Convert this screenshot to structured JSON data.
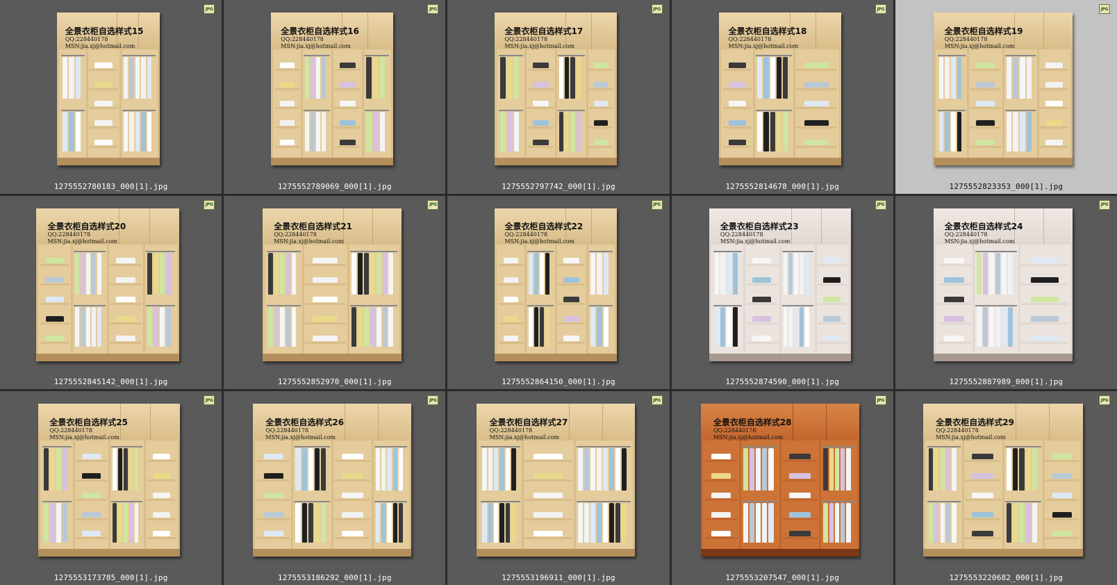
{
  "badge_label": "JPG",
  "wardrobe_text": {
    "qq": "QQ:228440178",
    "msn": "MSN:jia.xj@hotmail.com"
  },
  "colors": {
    "panel_bg": "#5a5a5a",
    "selected_bg": "#c3c3c3",
    "caption_text": "#ffffff",
    "light_wood": "#e0c594",
    "white_wood": "#e6dcd6",
    "orange_wood": "#c0692e"
  },
  "thumbnails": [
    {
      "caption": "1275552780183_000[1].jpg",
      "title": "全景衣柜自选样式15",
      "finish": "light",
      "selected": false
    },
    {
      "caption": "1275552789069_000[1].jpg",
      "title": "全景衣柜自选样式16",
      "finish": "light",
      "selected": false
    },
    {
      "caption": "1275552797742_000[1].jpg",
      "title": "全景衣柜自选样式17",
      "finish": "light",
      "selected": false
    },
    {
      "caption": "1275552814678_000[1].jpg",
      "title": "全景衣柜自选样式18",
      "finish": "light",
      "selected": false
    },
    {
      "caption": "1275552823353_000[1].jpg",
      "title": "全景衣柜自选样式19",
      "finish": "light",
      "selected": true
    },
    {
      "caption": "1275552845142_000[1].jpg",
      "title": "全景衣柜自选样式20",
      "finish": "light",
      "selected": false
    },
    {
      "caption": "1275552852970_000[1].jpg",
      "title": "全景衣柜自选样式21",
      "finish": "light",
      "selected": false
    },
    {
      "caption": "1275552864150_000[1].jpg",
      "title": "全景衣柜自选样式22",
      "finish": "light",
      "selected": false
    },
    {
      "caption": "1275552874590_000[1].jpg",
      "title": "全景衣柜自选样式23",
      "finish": "white",
      "selected": false
    },
    {
      "caption": "1275552887989_000[1].jpg",
      "title": "全景衣柜自选样式24",
      "finish": "white",
      "selected": false
    },
    {
      "caption": "1275553173785_000[1].jpg",
      "title": "全景衣柜自选样式25",
      "finish": "light",
      "selected": false
    },
    {
      "caption": "1275553186292_000[1].jpg",
      "title": "全景衣柜自选样式26",
      "finish": "light",
      "selected": false
    },
    {
      "caption": "1275553196911_000[1].jpg",
      "title": "全景衣柜自选样式27",
      "finish": "light",
      "selected": false
    },
    {
      "caption": "1275553207547_000[1].jpg",
      "title": "全景衣柜自选样式28",
      "finish": "orange",
      "selected": false
    },
    {
      "caption": "1275553220682_000[1].jpg",
      "title": "全景衣柜自选样式29",
      "finish": "light",
      "selected": false
    }
  ]
}
